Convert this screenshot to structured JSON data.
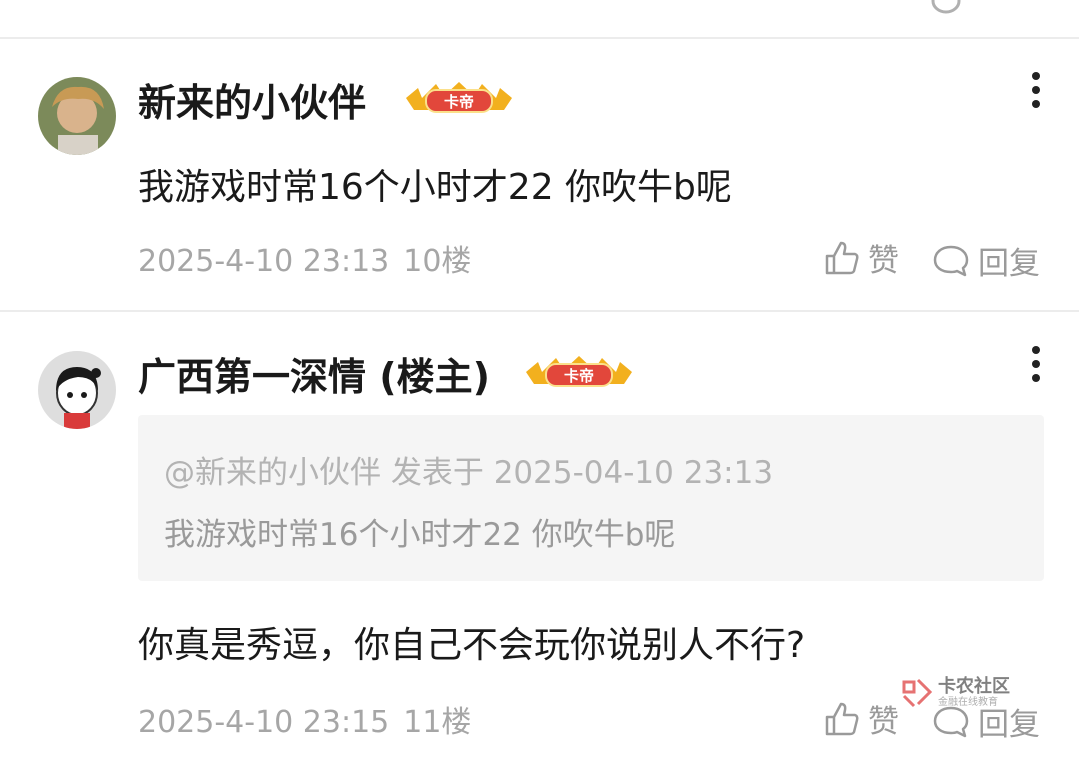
{
  "comments": [
    {
      "username": "新来的小伙伴",
      "badge": "卡帝",
      "content": "我游戏时常16个小时才22 你吹牛b呢",
      "time": "2025-4-10 23:13",
      "floor": "10楼",
      "like_label": "赞",
      "reply_label": "回复"
    },
    {
      "username": "广西第一深情 (楼主)",
      "badge": "卡帝",
      "quote_header": "@新来的小伙伴 发表于 2025-04-10 23:13",
      "quote_text": "我游戏时常16个小时才22 你吹牛b呢",
      "content": "你真是秀逗，你自己不会玩你说别人不行?",
      "time": "2025-4-10 23:15",
      "floor": "11楼",
      "like_label": "赞",
      "reply_label": "回复"
    }
  ],
  "watermark": {
    "title": "卡农社区",
    "subtitle": "金融在线教育"
  },
  "icons": [
    "more-vertical-icon",
    "thumbs-up-icon",
    "comment-bubble-icon",
    "crown-badge-icon",
    "avatar-photo",
    "avatar-cartoon",
    "kanong-logo-icon"
  ],
  "colors": {
    "badge_red": "#e2473b",
    "badge_gold": "#f2b01e",
    "meta_gray": "#a6a6a6",
    "quote_bg": "#f5f5f5"
  }
}
